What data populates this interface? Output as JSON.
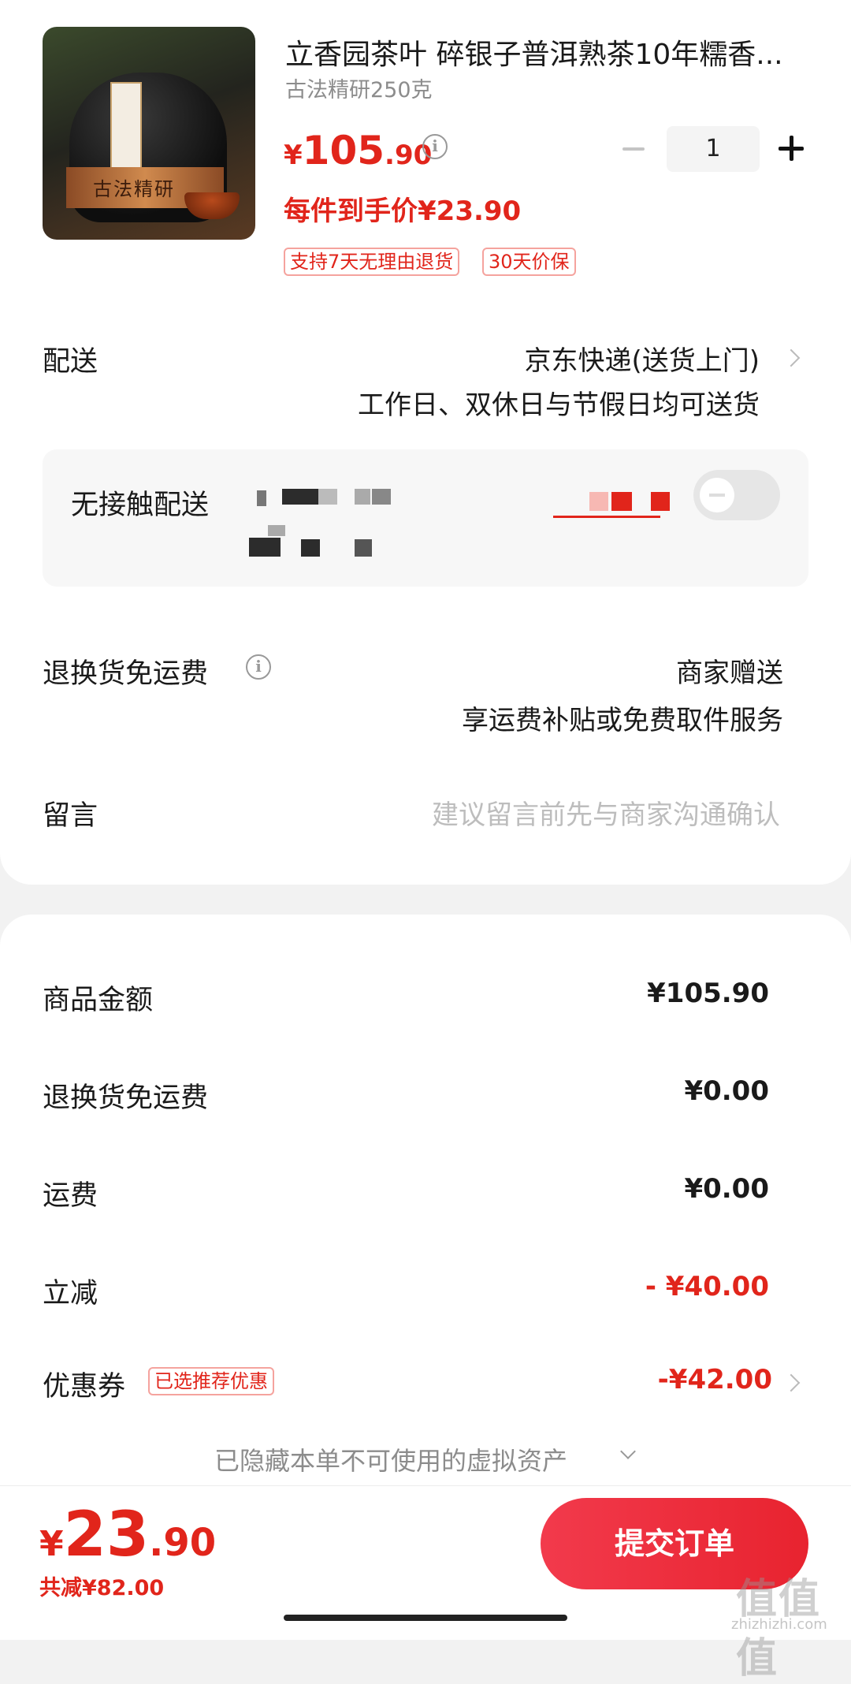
{
  "product": {
    "title": "立香园茶叶 碎银子普洱熟茶10年糯香...",
    "spec": "古法精研250克",
    "image_text": "古法精研",
    "price_currency": "¥",
    "price_integer": "105",
    "price_decimal": ".90",
    "unit_price": "每件到手价¥23.90",
    "quantity": "1",
    "tags": [
      "支持7天无理由退货",
      "30天价保"
    ]
  },
  "delivery": {
    "label": "配送",
    "method": "京东快递(送货上门)",
    "note": "工作日、双休日与节假日均可送货"
  },
  "contactless": {
    "label": "无接触配送",
    "enabled": false
  },
  "return_shipping": {
    "label": "退换货免运费",
    "value": "商家赠送",
    "note": "享运费补贴或免费取件服务"
  },
  "message": {
    "label": "留言",
    "placeholder": "建议留言前先与商家沟通确认"
  },
  "summary": {
    "goods_amount_label": "商品金额",
    "goods_amount": "¥105.90",
    "return_shipping_label": "退换货免运费",
    "return_shipping": "¥0.00",
    "shipping_label": "运费",
    "shipping": "¥0.00",
    "instant_discount_label": "立减",
    "instant_discount": "- ¥40.00",
    "coupon_label": "优惠券",
    "coupon_tag": "已选推荐优惠",
    "coupon": "-¥42.00",
    "hidden_assets": "已隐藏本单不可使用的虚拟资产"
  },
  "checkout": {
    "total_currency": "¥",
    "total_integer": "23",
    "total_decimal": ".90",
    "total_discount": "共减¥82.00",
    "submit_label": "提交订单"
  },
  "watermark": {
    "logo": "值值值",
    "url": "zhizhizhi.com"
  },
  "colors": {
    "accent": "#e1251b",
    "submit_gradient_start": "#f23a4c",
    "submit_gradient_end": "#e8232f"
  }
}
